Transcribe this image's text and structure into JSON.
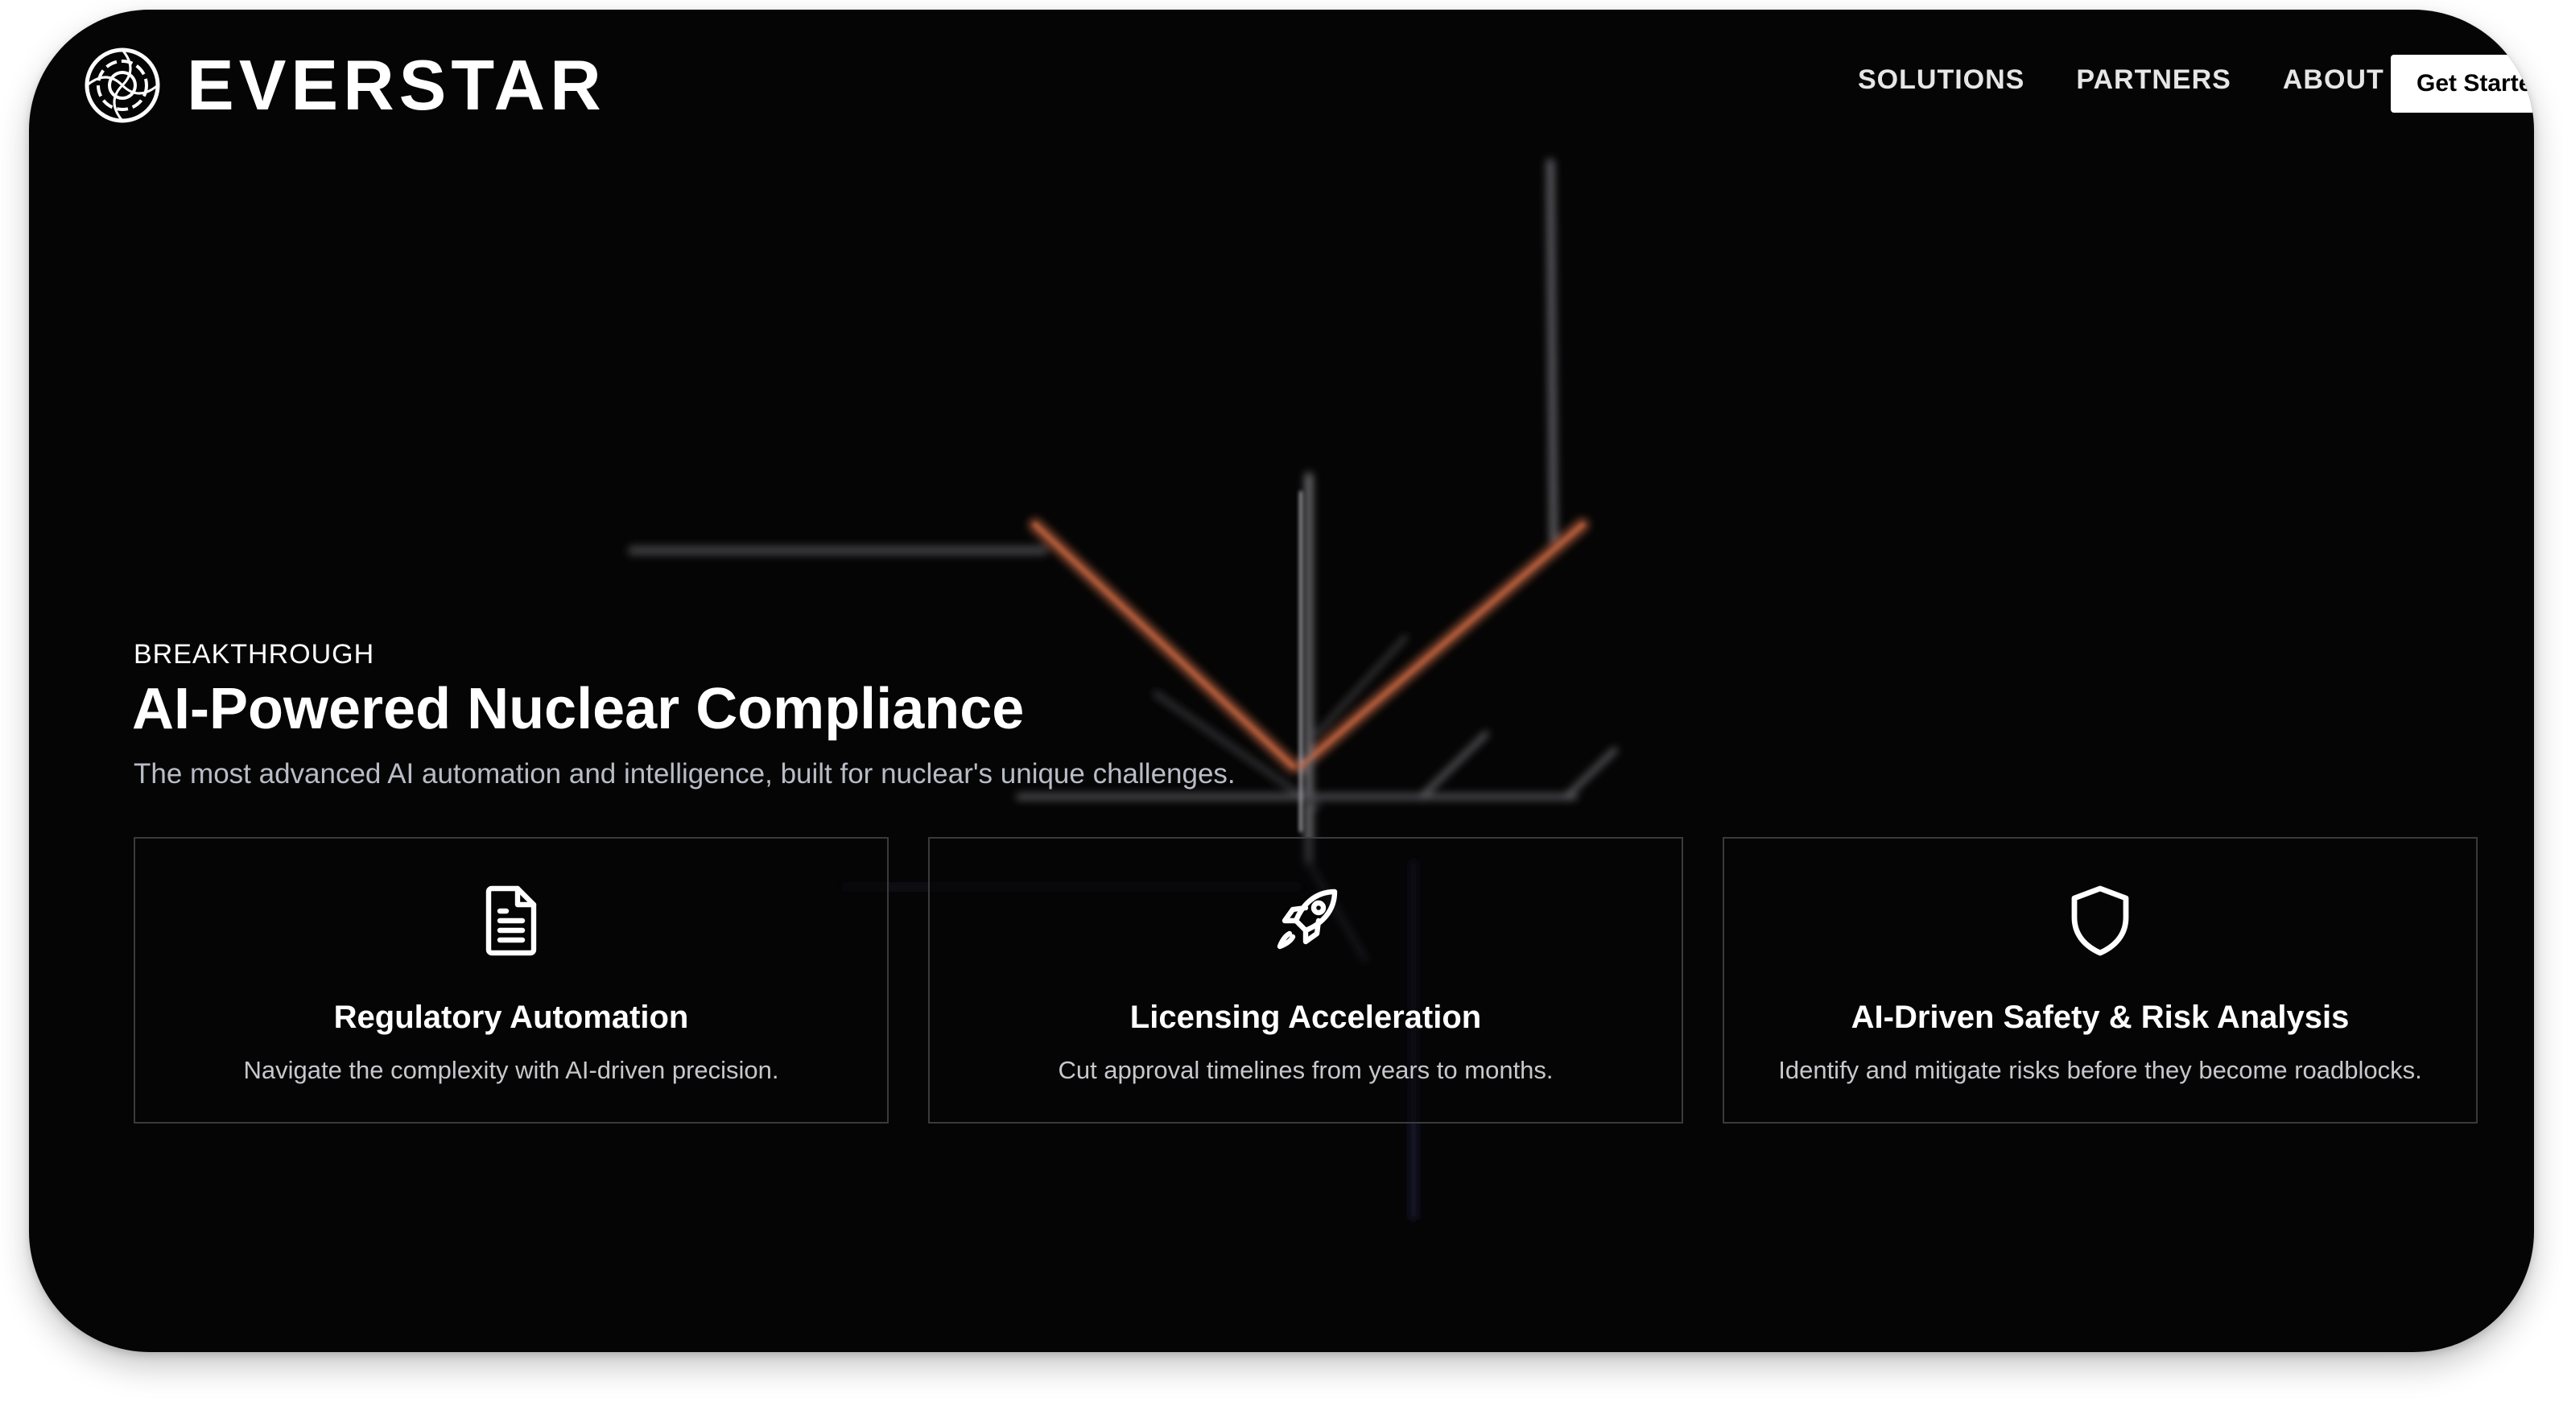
{
  "brand": {
    "name": "EVERSTAR",
    "logo_icon": "everstar-ring-icon"
  },
  "nav": {
    "items": [
      "SOLUTIONS",
      "PARTNERS",
      "ABOUT"
    ],
    "cta_label": "Get Started"
  },
  "hero": {
    "eyebrow": "BREAKTHROUGH",
    "title": "AI-Powered Nuclear Compliance",
    "subtitle": "The most advanced AI automation and intelligence, built for nuclear's unique challenges."
  },
  "features": [
    {
      "icon": "document-icon",
      "title": "Regulatory Automation",
      "description": "Navigate the complexity with AI-driven precision."
    },
    {
      "icon": "rocket-icon",
      "title": "Licensing Acceleration",
      "description": "Cut approval timelines from years to months."
    },
    {
      "icon": "shield-icon",
      "title": "AI-Driven Safety & Risk Analysis",
      "description": "Identify and mitigate risks before they become roadblocks."
    }
  ],
  "colors": {
    "background": "#050505",
    "text": "#ffffff",
    "muted_text": "#b9bcc6",
    "accent_orange": "#c8663e",
    "card_border": "#3a3a3e"
  }
}
